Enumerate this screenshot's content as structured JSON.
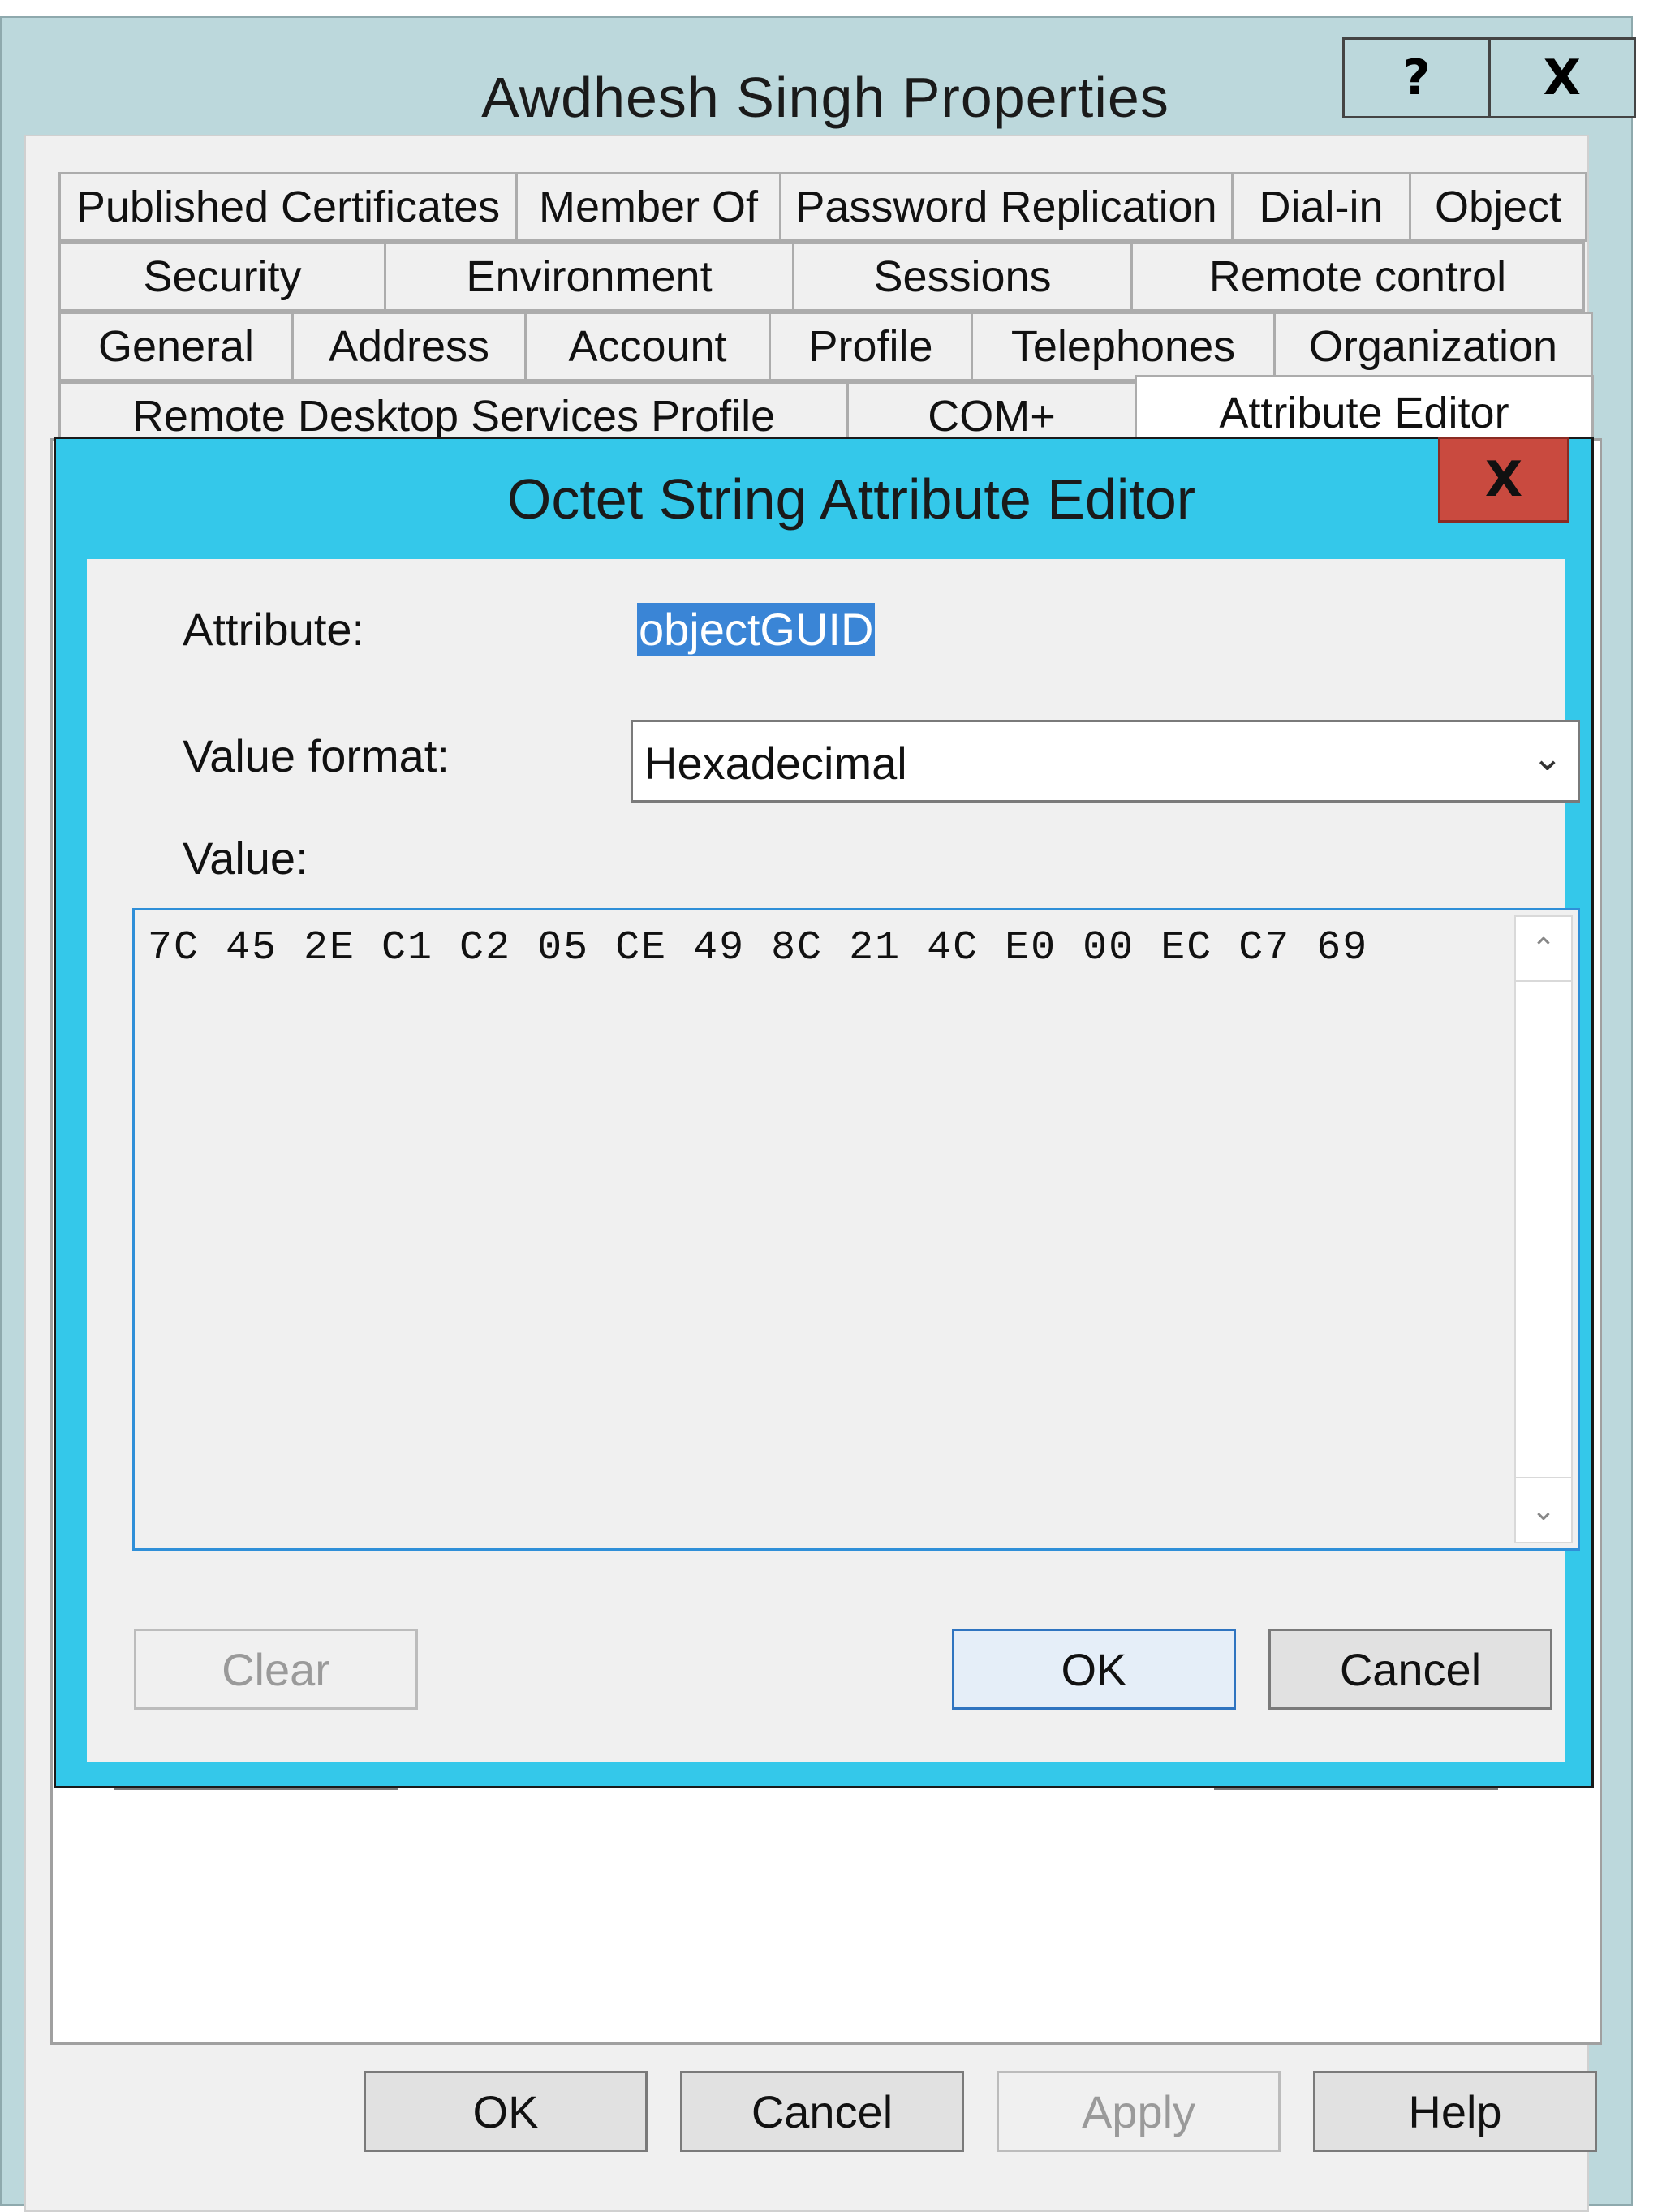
{
  "window": {
    "title": "Awdhesh Singh Properties",
    "help_icon": "?",
    "close_icon": "X"
  },
  "tabs": {
    "row1": [
      "Published Certificates",
      "Member Of",
      "Password Replication",
      "Dial-in",
      "Object"
    ],
    "row2": [
      "Security",
      "Environment",
      "Sessions",
      "Remote control"
    ],
    "row3": [
      "General",
      "Address",
      "Account",
      "Profile",
      "Telephones",
      "Organization"
    ],
    "row4": [
      "Remote Desktop Services Profile",
      "COM+",
      "Attribute Editor"
    ]
  },
  "footer": {
    "ok": "OK",
    "cancel": "Cancel",
    "apply": "Apply",
    "help": "Help"
  },
  "dialog": {
    "title": "Octet String Attribute Editor",
    "close_icon": "X",
    "attribute_label": "Attribute:",
    "attribute_value": "objectGUID",
    "value_format_label": "Value format:",
    "value_format_selected": "Hexadecimal",
    "value_label": "Value:",
    "value": "7C 45 2E C1 C2 05 CE 49 8C 21 4C E0 00 EC C7 69",
    "clear": "Clear",
    "ok": "OK",
    "cancel": "Cancel"
  }
}
